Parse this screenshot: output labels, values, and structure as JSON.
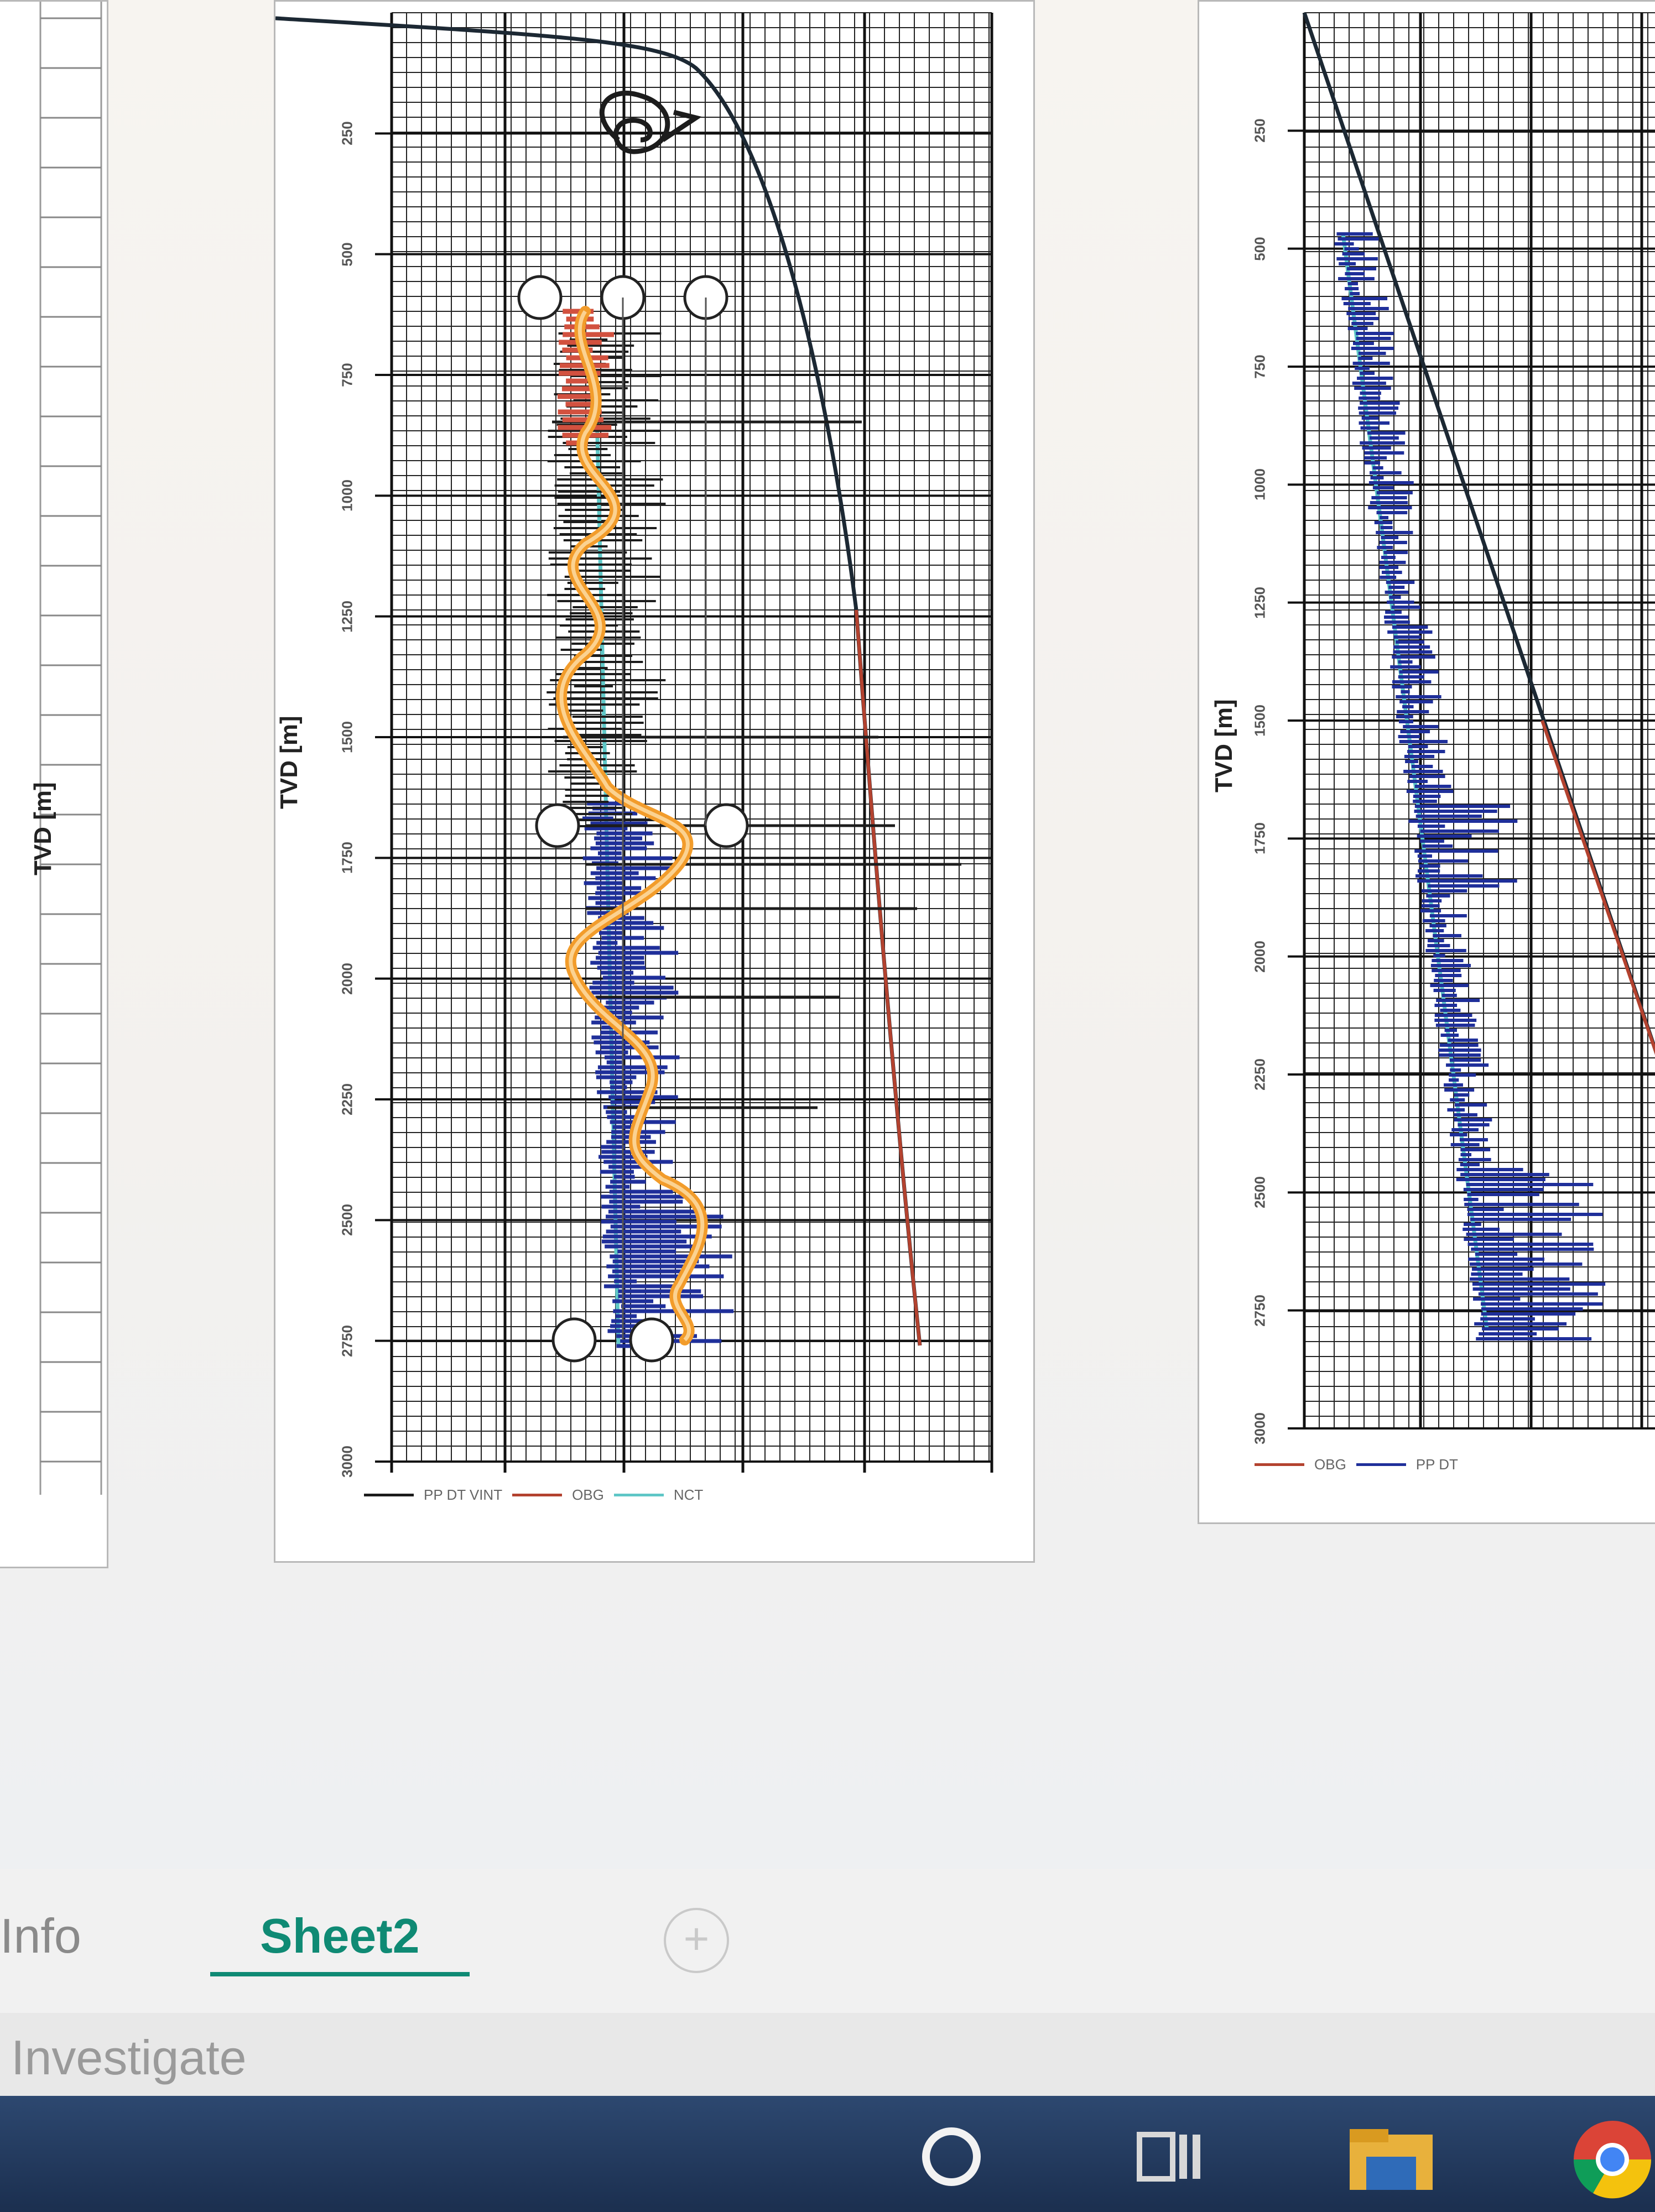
{
  "charts": [
    {
      "id": "left",
      "ylabel": "TVD [m]",
      "yticks": [
        "250",
        "500",
        "750",
        "1000",
        "1250",
        "1500",
        "1750",
        "2000",
        "2250",
        "2500",
        "2750",
        "3000"
      ],
      "legend": [
        {
          "label": "PP DT VINT",
          "color": "#1c1c1c"
        },
        {
          "label": "OBG",
          "color": "#b3422f"
        },
        {
          "label": "NCT",
          "color": "#5fc7c7"
        }
      ]
    },
    {
      "id": "right",
      "ylabel": "TVD [m]",
      "yticks": [
        "250",
        "500",
        "750",
        "1000",
        "1250",
        "1500",
        "1750",
        "2000",
        "2250",
        "2500",
        "2750",
        "3000"
      ],
      "legend": [
        {
          "label": "OBG",
          "color": "#b3422f"
        },
        {
          "label": "PP DT",
          "color": "#1f2f9a"
        }
      ]
    }
  ],
  "partial_chart": {
    "ylabel": "TVD [m]"
  },
  "sheet_tabs": [
    {
      "label": "Info",
      "active": false
    },
    {
      "label": "Sheet2",
      "active": true
    }
  ],
  "add_sheet_icon": "plus-circle-icon",
  "status": {
    "text": "Investigate"
  },
  "taskbar": {
    "icons": [
      "cortana-icon",
      "task-view-icon",
      "file-explorer-icon",
      "chrome-icon"
    ]
  },
  "colors": {
    "accent": "#0f8a74",
    "obg": "#b3422f",
    "nct": "#5fc7c7",
    "dt": "#1f2f9a",
    "smoothed": "#f29c2b"
  }
}
